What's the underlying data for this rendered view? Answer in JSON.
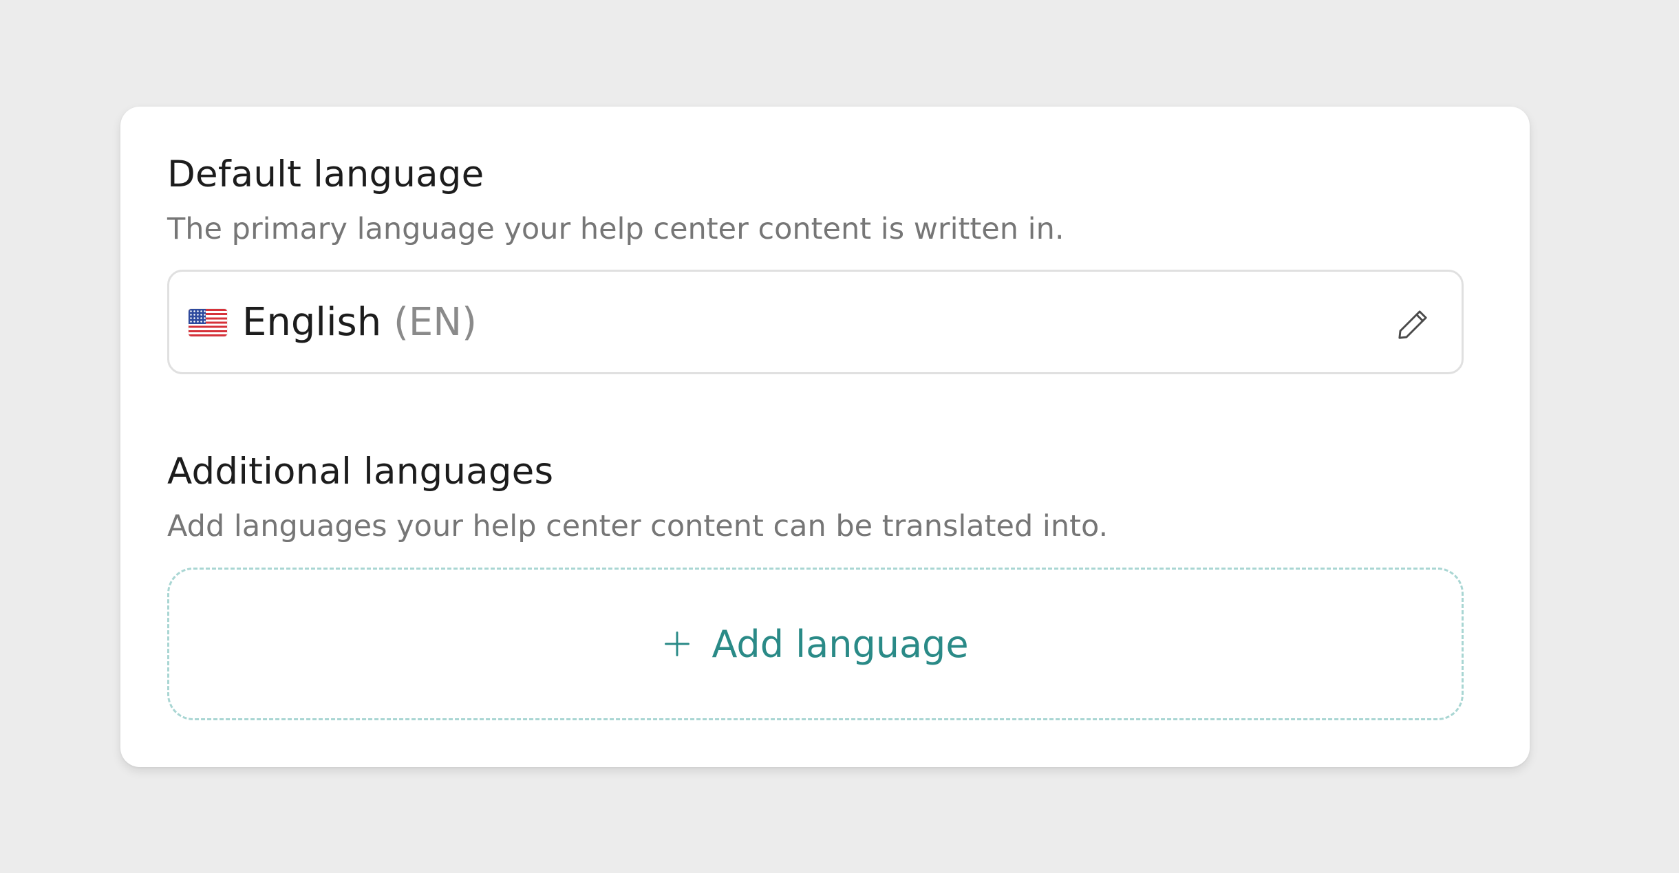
{
  "default_language": {
    "title": "Default language",
    "description": "The primary language your help center content is written in.",
    "selected": {
      "flag_icon": "us-flag-icon",
      "name": "English",
      "code": "(EN)"
    },
    "edit_icon": "pencil-icon"
  },
  "additional_languages": {
    "title": "Additional languages",
    "description": "Add languages your help center content can be translated into.",
    "add_button": {
      "icon": "plus-icon",
      "label": "Add language"
    }
  },
  "colors": {
    "accent": "#2a8a87",
    "dashed_border": "#a9d6d3",
    "page_background": "#ececec"
  }
}
